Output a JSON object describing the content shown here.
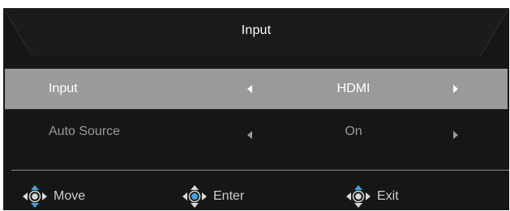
{
  "header": {
    "title": "Input"
  },
  "menu": {
    "items": [
      {
        "label": "Input",
        "value": "HDMI",
        "selected": true
      },
      {
        "label": "Auto Source",
        "value": "On",
        "selected": false
      }
    ]
  },
  "footer": {
    "hints": [
      {
        "label": "Move",
        "icon": "dpad-up-down-icon"
      },
      {
        "label": "Enter",
        "icon": "dpad-center-icon"
      },
      {
        "label": "Exit",
        "icon": "dpad-up-icon"
      }
    ]
  },
  "colors": {
    "background": "#161616",
    "selected_row": "#9a9a9a",
    "accent_blue": "#3aa6e0"
  }
}
